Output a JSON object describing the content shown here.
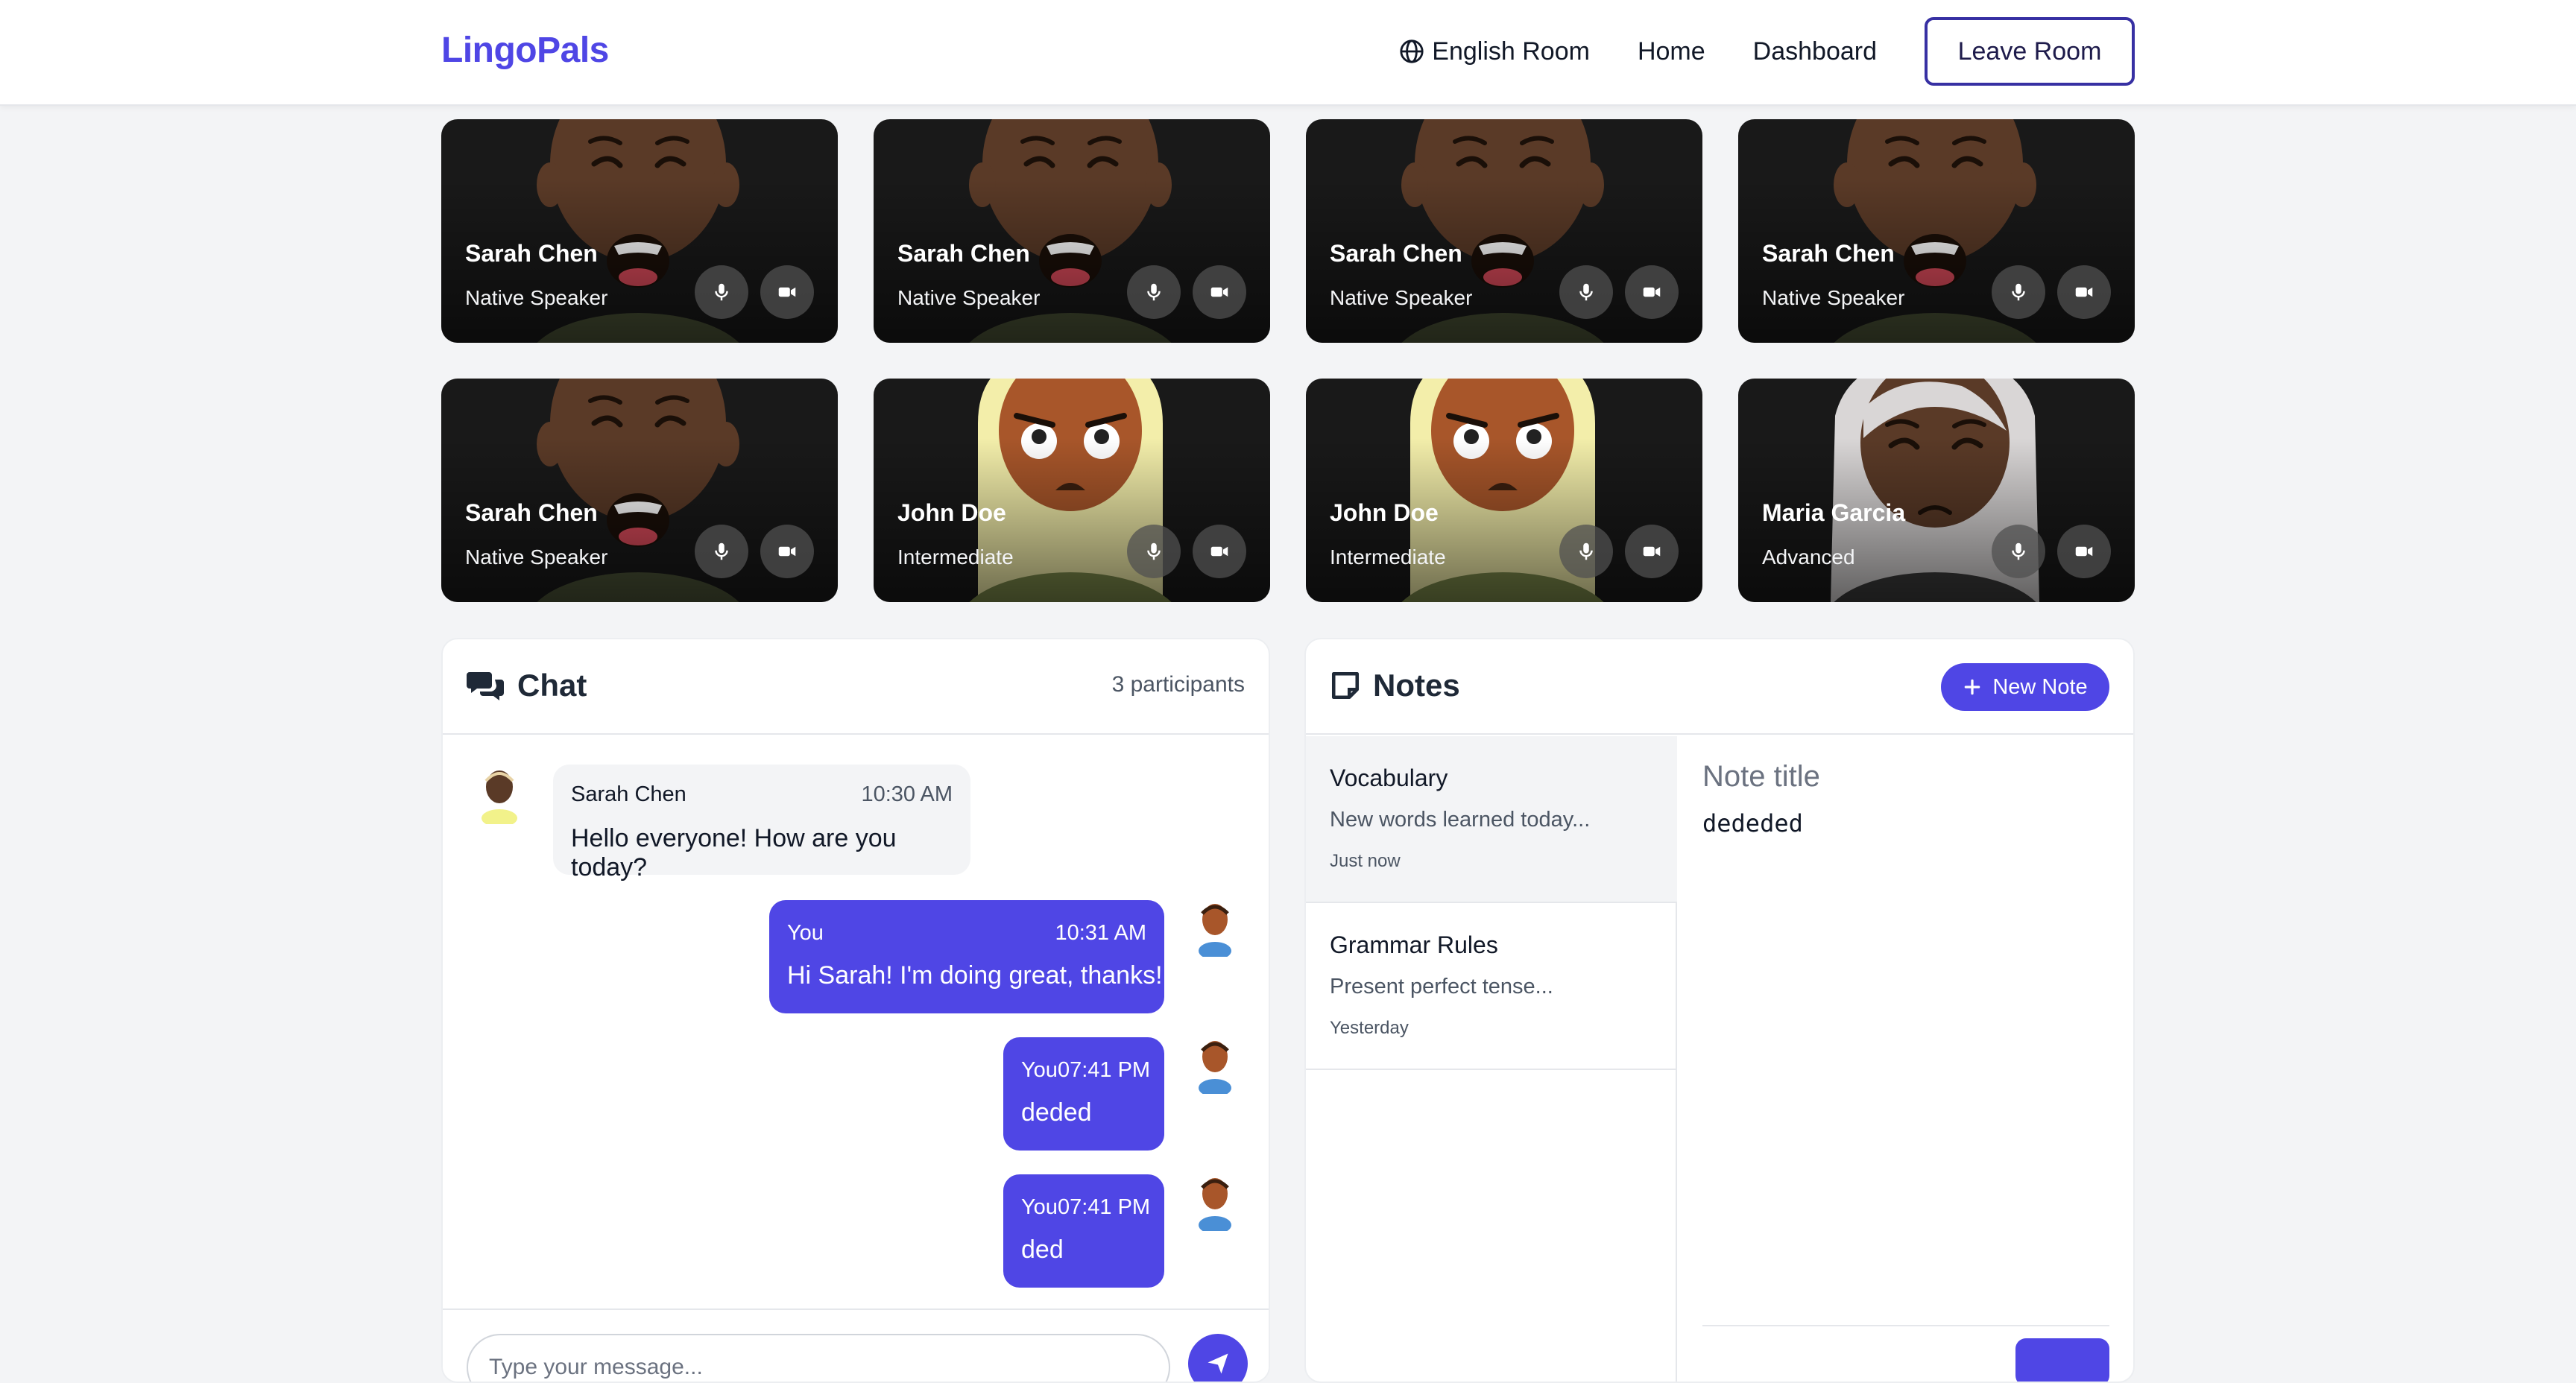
{
  "app": {
    "brand": "LingoPals"
  },
  "nav": {
    "room_label": "English Room",
    "home": "Home",
    "dashboard": "Dashboard",
    "leave": "Leave Room"
  },
  "video_tiles": [
    {
      "name": "Sarah Chen",
      "role": "Native Speaker"
    },
    {
      "name": "Sarah Chen",
      "role": "Native Speaker"
    },
    {
      "name": "Sarah Chen",
      "role": "Native Speaker"
    },
    {
      "name": "Sarah Chen",
      "role": "Native Speaker"
    },
    {
      "name": "Sarah Chen",
      "role": "Native Speaker"
    },
    {
      "name": "John Doe",
      "role": "Intermediate"
    },
    {
      "name": "John Doe",
      "role": "Intermediate"
    },
    {
      "name": "Maria Garcia",
      "role": "Advanced"
    }
  ],
  "chat": {
    "title": "Chat",
    "participants": "3 participants",
    "messages": [
      {
        "sender": "Sarah Chen",
        "time": "10:30 AM",
        "text": "Hello everyone! How are you today?"
      },
      {
        "sender": "You",
        "time": "10:31 AM",
        "text": "Hi Sarah! I'm doing great, thanks!"
      },
      {
        "sender_time": "You07:41 PM",
        "text": "deded"
      },
      {
        "sender_time": "You07:41 PM",
        "text": "ded"
      }
    ],
    "input_placeholder": "Type your message..."
  },
  "notes": {
    "title": "Notes",
    "new_button": "New Note",
    "items": [
      {
        "title": "Vocabulary",
        "preview": "New words learned today...",
        "date": "Just now"
      },
      {
        "title": "Grammar Rules",
        "preview": "Present perfect tense...",
        "date": "Yesterday"
      }
    ],
    "editor": {
      "title_placeholder": "Note title",
      "body": "dededed"
    }
  },
  "colors": {
    "accent": "#4f46e5",
    "page_bg": "#f3f4f6",
    "tile_bg": "#191919"
  }
}
